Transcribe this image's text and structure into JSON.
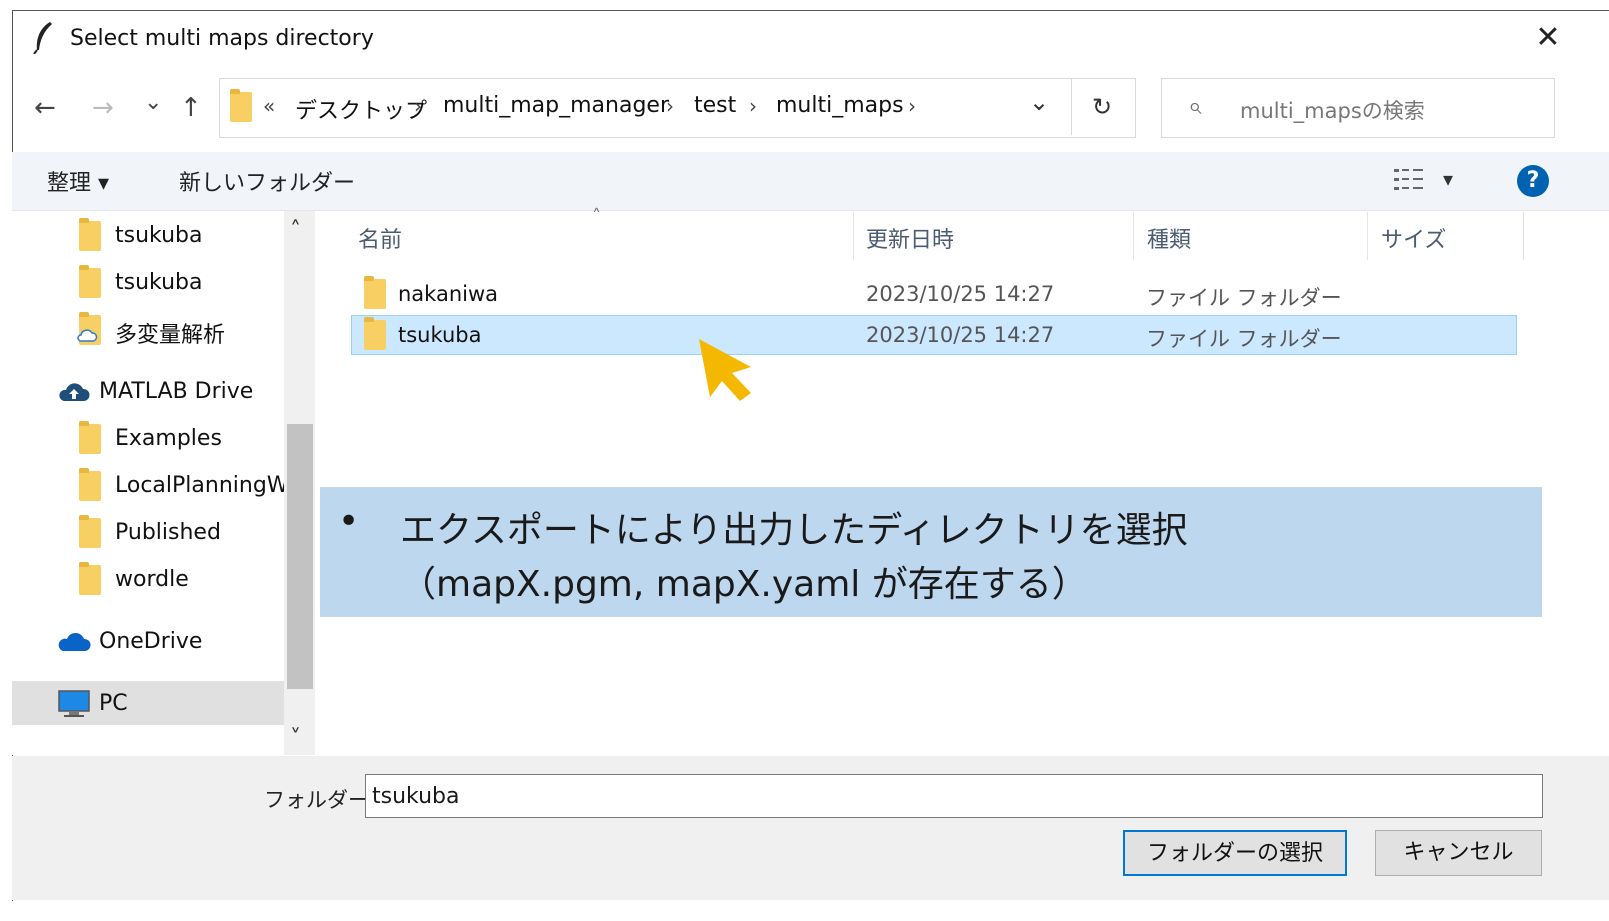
{
  "window": {
    "title": "Select multi maps directory",
    "close_glyph": "✕"
  },
  "nav": {
    "back": "←",
    "forward": "→",
    "recent": "⌄",
    "up": "↑",
    "overflow": "«",
    "dropdown": "⌄",
    "refresh": "↻"
  },
  "breadcrumb": [
    "デスクトップ",
    "multi_map_manager",
    "test",
    "multi_maps"
  ],
  "breadcrumb_sep": "›",
  "search": {
    "placeholder": "multi_mapsの検索",
    "icon": "⌕"
  },
  "toolbar": {
    "organize": "整理 ▾",
    "new_folder": "新しいフォルダー",
    "view_caret": "▾",
    "help": "?"
  },
  "sidebar": {
    "items": [
      {
        "label": "tsukuba",
        "icon": "folder-icon"
      },
      {
        "label": "tsukuba",
        "icon": "folder-icon"
      },
      {
        "label": "多変量解析",
        "icon": "cloud-folder-icon"
      },
      {
        "label": "MATLAB Drive",
        "icon": "cloud-upload-icon"
      },
      {
        "label": "Examples",
        "icon": "folder-icon"
      },
      {
        "label": "LocalPlanningW",
        "icon": "folder-icon"
      },
      {
        "label": "Published",
        "icon": "folder-icon"
      },
      {
        "label": "wordle",
        "icon": "folder-icon"
      },
      {
        "label": "OneDrive",
        "icon": "onedrive-icon"
      },
      {
        "label": "PC",
        "icon": "pc-icon"
      }
    ],
    "scroll_up": "˄",
    "scroll_down": "˅"
  },
  "columns": {
    "name": "名前",
    "modified": "更新日時",
    "type": "種類",
    "size": "サイズ",
    "sort_indicator": "˄"
  },
  "files": [
    {
      "name": "nakaniwa",
      "modified": "2023/10/25 14:27",
      "type": "ファイル フォルダー"
    },
    {
      "name": "tsukuba",
      "modified": "2023/10/25 14:27",
      "type": "ファイル フォルダー"
    }
  ],
  "annotation": {
    "bullet": "•",
    "line1": "エクスポートにより出力したディレクトリを選択",
    "line2": "（mapX.pgm, mapX.yaml が存在する）"
  },
  "footer": {
    "folder_label": "フォルダー:",
    "folder_value": "tsukuba",
    "select_button": "フォルダーの選択",
    "cancel_button": "キャンセル"
  },
  "colors": {
    "selection": "#cce8ff",
    "annotation_bg": "#bdd7ee",
    "cursor": "#f5b800",
    "help": "#0063b1"
  }
}
